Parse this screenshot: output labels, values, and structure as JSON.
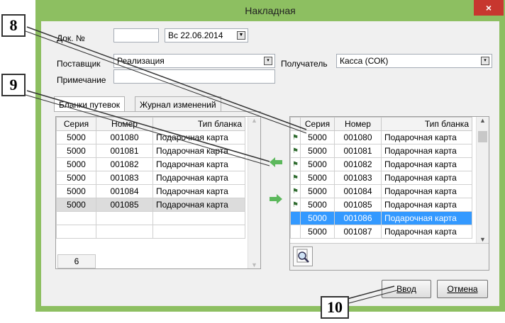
{
  "window": {
    "title": "Накладная",
    "close_glyph": "×"
  },
  "form": {
    "doc_no_label": "Док. №",
    "doc_no_value": "",
    "date_value": "Вс  22.06.2014",
    "supplier_label": "Поставщик",
    "supplier_value": "Реализация",
    "recipient_label": "Получатель",
    "recipient_value": "Касса (СОК)",
    "note_label": "Примечание",
    "note_value": ""
  },
  "tabs": [
    {
      "label": "Бланки путевок"
    },
    {
      "label": "Журнал изменений"
    }
  ],
  "columns": [
    "Серия",
    "Номер",
    "Тип бланка"
  ],
  "left_rows": [
    [
      "5000",
      "001080",
      "Подарочная карта"
    ],
    [
      "5000",
      "001081",
      "Подарочная карта"
    ],
    [
      "5000",
      "001082",
      "Подарочная карта"
    ],
    [
      "5000",
      "001083",
      "Подарочная карта"
    ],
    [
      "5000",
      "001084",
      "Подарочная карта"
    ],
    [
      "5000",
      "001085",
      "Подарочная карта"
    ]
  ],
  "left_count": "6",
  "right_rows": [
    [
      "5000",
      "001080",
      "Подарочная карта"
    ],
    [
      "5000",
      "001081",
      "Подарочная карта"
    ],
    [
      "5000",
      "001082",
      "Подарочная карта"
    ],
    [
      "5000",
      "001083",
      "Подарочная карта"
    ],
    [
      "5000",
      "001084",
      "Подарочная карта"
    ],
    [
      "5000",
      "001085",
      "Подарочная карта"
    ],
    [
      "5000",
      "001086",
      "Подарочная карта"
    ],
    [
      "5000",
      "001087",
      "Подарочная карта"
    ]
  ],
  "buttons": {
    "ok": "Ввод",
    "cancel": "Отмена"
  },
  "callouts": [
    "8",
    "9",
    "10"
  ],
  "colors": {
    "frame": "#8dbf61",
    "selection": "#3399ff",
    "close": "#c7372f",
    "arrow": "#4caf50"
  },
  "icons": {
    "flag": "flag-icon",
    "arrow_left": "arrow-left-icon",
    "arrow_right": "arrow-right-icon",
    "search": "magnifier-icon"
  }
}
